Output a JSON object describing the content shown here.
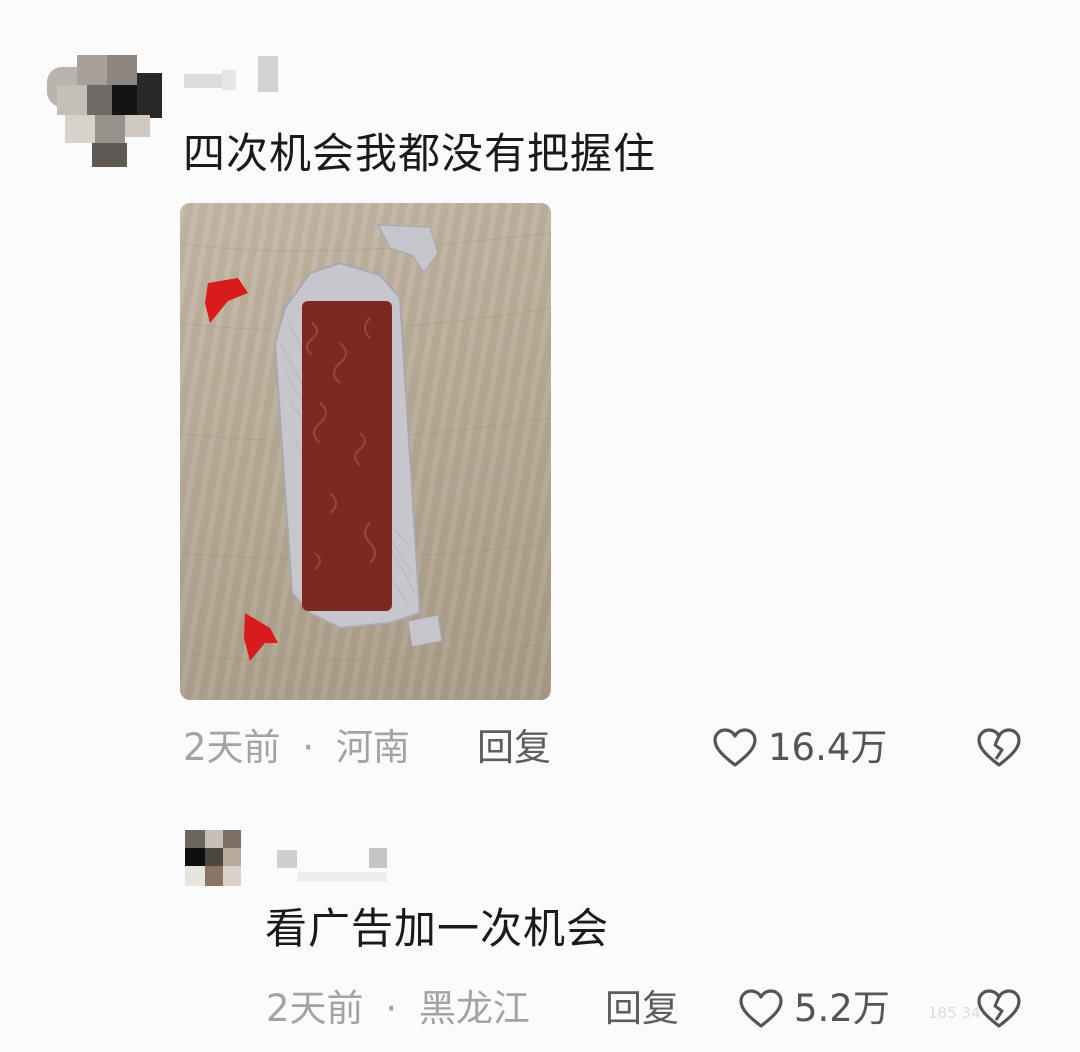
{
  "comment": {
    "text": "四次机会我都没有把握住",
    "time": "2天前",
    "separator": "·",
    "location": "河南",
    "reply_label": "回复",
    "likes": "16.4万"
  },
  "reply": {
    "text": "看广告加一次机会",
    "time": "2天前",
    "separator": "·",
    "location": "黑龙江",
    "reply_label": "回复",
    "likes": "5.2万"
  },
  "watermark": "185 34",
  "icons": {
    "like": "heart-outline-icon",
    "dislike": "broken-heart-icon"
  },
  "colors": {
    "background": "#fbfbfb",
    "meta_text": "#a3a3a3",
    "candy_red": "#8a2e22"
  }
}
